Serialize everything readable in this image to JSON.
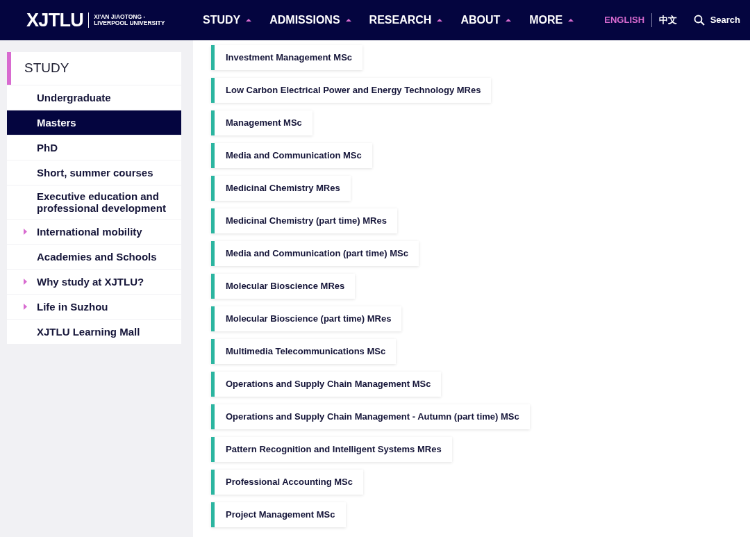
{
  "header": {
    "logo": {
      "mark": "XJTLU",
      "line_1": "XI'AN JIAOTONG -",
      "line_2": "LIVERPOOL UNIVERSITY"
    },
    "nav": [
      {
        "label": "STUDY"
      },
      {
        "label": "ADMISSIONS"
      },
      {
        "label": "RESEARCH"
      },
      {
        "label": "ABOUT"
      },
      {
        "label": "MORE"
      }
    ],
    "languages": [
      {
        "label": "ENGLISH",
        "selected": true
      },
      {
        "label": "中文",
        "selected": false
      }
    ],
    "search": {
      "label": "Search"
    }
  },
  "sidebar": {
    "title": "STUDY",
    "items": [
      {
        "label": "Undergraduate",
        "selected": false,
        "expandable": false
      },
      {
        "label": "Masters",
        "selected": true,
        "expandable": false
      },
      {
        "label": "PhD",
        "selected": false,
        "expandable": false
      },
      {
        "label": "Short, summer courses",
        "selected": false,
        "expandable": false
      },
      {
        "label": "Executive education and professional development",
        "selected": false,
        "expandable": false
      },
      {
        "label": "International mobility",
        "selected": false,
        "expandable": true
      },
      {
        "label": "Academies and Schools",
        "selected": false,
        "expandable": false
      },
      {
        "label": "Why study at XJTLU?",
        "selected": false,
        "expandable": true
      },
      {
        "label": "Life in Suzhou",
        "selected": false,
        "expandable": true
      },
      {
        "label": "XJTLU Learning Mall",
        "selected": false,
        "expandable": false
      }
    ]
  },
  "programmes": [
    "Investment Management MSc",
    "Low Carbon Electrical Power and Energy Technology MRes",
    "Management MSc",
    "Media and Communication MSc",
    "Medicinal Chemistry MRes",
    "Medicinal Chemistry (part time) MRes",
    "Media and Communication (part time) MSc",
    "Molecular Bioscience MRes",
    "Molecular Bioscience (part time) MRes",
    "Multimedia Telecommunications MSc",
    "Operations and Supply Chain Management MSc",
    "Operations and Supply Chain Management - Autumn (part time) MSc",
    "Pattern Recognition and Intelligent Systems MRes",
    "Professional Accounting MSc",
    "Project Management MSc"
  ]
}
